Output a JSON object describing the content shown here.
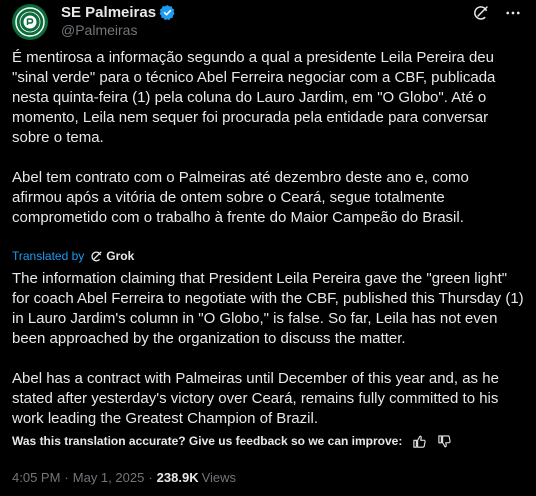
{
  "header": {
    "display_name": "SE Palmeiras",
    "handle": "@Palmeiras"
  },
  "post": {
    "text": "É mentirosa a informação segundo a qual a presidente Leila Pereira deu \"sinal verde\" para o técnico Abel Ferreira negociar com a CBF, publicada nesta quinta-feira (1) pela coluna do Lauro Jardim, em \"O Globo\". Até o momento, Leila nem sequer foi procurada pela entidade para conversar sobre o tema.\n\nAbel tem contrato com o Palmeiras até dezembro deste ano e, como afirmou após a vitória de ontem sobre o Ceará, segue totalmente comprometido com o trabalho à frente do Maior Campeão do Brasil."
  },
  "translation": {
    "label": "Translated by",
    "provider": "Grok",
    "text": "The information claiming that President Leila Pereira gave the \"green light\" for coach Abel Ferreira to negotiate with the CBF, published this Thursday (1) in Lauro Jardim's column in \"O Globo,\" is false. So far, Leila has not even been approached by the organization to discuss the matter.\n\nAbel has a contract with Palmeiras until December of this year and, as he stated after yesterday's victory over Ceará, remains fully committed to his work leading the Greatest Champion of Brazil.",
    "feedback_prompt": "Was this translation accurate? Give us feedback so we can improve:"
  },
  "meta": {
    "time": "4:05 PM",
    "separator": "·",
    "date": "May 1, 2025",
    "views_count": "238.9K",
    "views_label": "Views"
  },
  "colors": {
    "background": "#000000",
    "text": "#e7e9ea",
    "muted": "#71767b",
    "accent": "#1d9bf0",
    "verified": "#1d9bf0",
    "brand_green": "#0b6b3a"
  },
  "icons": {
    "avatar": "palmeiras-crest-icon",
    "verified": "verified-badge-icon",
    "grok_header": "grok-icon",
    "more": "more-icon",
    "grok_inline": "grok-icon",
    "thumbs_up": "thumbs-up-icon",
    "thumbs_down": "thumbs-down-icon"
  }
}
